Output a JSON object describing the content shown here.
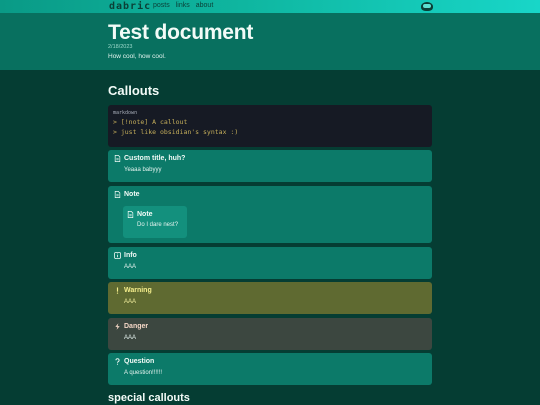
{
  "nav": {
    "brand": "dabric",
    "links": [
      "posts",
      "links",
      "about"
    ]
  },
  "header": {
    "title": "Test document",
    "date": "2/18/2023",
    "subtitle": "How cool, how cool."
  },
  "sections": {
    "callouts_heading": "Callouts",
    "special_heading": "special callouts"
  },
  "codeblock": {
    "language": "markdown",
    "lines": [
      "> [!note] A callout",
      "> just like obsidian's syntax :)"
    ]
  },
  "callouts": {
    "custom": {
      "title": "Custom title, huh?",
      "body": "Yeaaa babyyy",
      "icon": "note-icon"
    },
    "note": {
      "title": "Note",
      "icon": "note-icon",
      "nested": {
        "title": "Note",
        "body": "Do I dare nest?",
        "icon": "note-icon"
      }
    },
    "info": {
      "title": "Info",
      "body": "AAA",
      "icon": "info-icon"
    },
    "warning": {
      "title": "Warning",
      "body": "AAA",
      "icon": "exclamation-icon"
    },
    "danger": {
      "title": "Danger",
      "body": "AAA",
      "icon": "lightning-icon"
    },
    "question": {
      "title": "Question",
      "body": "A question!!!!!!",
      "icon": "question-icon"
    }
  },
  "colors": {
    "background": "#053d33",
    "header_band": "#08705f",
    "callout": "#0c7a69",
    "warning_callout": "#5f6a31",
    "danger_callout": "#3c4740",
    "codeblock": "#161a24"
  }
}
